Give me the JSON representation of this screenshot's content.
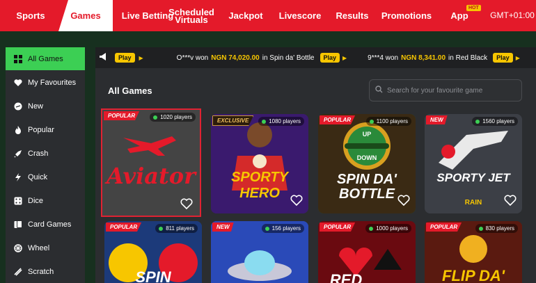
{
  "nav": {
    "items": [
      {
        "label": "Sports"
      },
      {
        "label": "Games"
      },
      {
        "label": "Live Betting"
      },
      {
        "label": "Scheduled"
      },
      {
        "label": "Virtuals"
      },
      {
        "label": "Jackpot"
      },
      {
        "label": "Livescore"
      },
      {
        "label": "Results"
      },
      {
        "label": "Promotions"
      },
      {
        "label": "App"
      },
      {
        "label": "GMT+01:00"
      }
    ],
    "hot_badge": "HOT",
    "active": "Games"
  },
  "sidebar": {
    "items": [
      {
        "label": "All Games",
        "icon": "grid-icon"
      },
      {
        "label": "My Favourites",
        "icon": "heart-icon"
      },
      {
        "label": "New",
        "icon": "new-badge-icon"
      },
      {
        "label": "Popular",
        "icon": "flame-icon"
      },
      {
        "label": "Crash",
        "icon": "rocket-icon"
      },
      {
        "label": "Quick",
        "icon": "lightning-icon"
      },
      {
        "label": "Dice",
        "icon": "dice-icon"
      },
      {
        "label": "Card Games",
        "icon": "cards-icon"
      },
      {
        "label": "Wheel",
        "icon": "wheel-icon"
      },
      {
        "label": "Scratch",
        "icon": "scratch-icon"
      }
    ],
    "active": "All Games"
  },
  "ticker": {
    "play_label": "Play",
    "entries": [
      {
        "user": "O***v won",
        "amount": "NGN 74,020.00",
        "game": "in Spin da' Bottle"
      },
      {
        "user": "9***4 won",
        "amount": "NGN 8,341.00",
        "game": "in Red Black"
      }
    ]
  },
  "main": {
    "title": "All Games",
    "search_placeholder": "Search for your favourite game"
  },
  "games": [
    {
      "name": "Aviator",
      "tag": "POPULAR",
      "players": "1020 players"
    },
    {
      "name": "SPORTY HERO",
      "tag": "EXCLUSIVE",
      "players": "1080 players"
    },
    {
      "name": "SPIN DA' BOTTLE",
      "tag": "POPULAR",
      "players": "1100 players",
      "up": "UP",
      "down": "DOWN"
    },
    {
      "name": "SPORTY JET",
      "tag": "NEW",
      "players": "1560 players",
      "sub": "RAIN"
    },
    {
      "name": "SPIN",
      "tag": "POPULAR",
      "players": "811 players"
    },
    {
      "name": "",
      "tag": "NEW",
      "players": "156 players"
    },
    {
      "name": "RED",
      "tag": "POPULAR",
      "players": "1000 players"
    },
    {
      "name": "FLIP DA'",
      "tag": "POPULAR",
      "players": "830 players"
    }
  ],
  "colors": {
    "brand_red": "#e41a2a",
    "accent_green": "#3ccf54",
    "accent_yellow": "#f7c600",
    "panel": "#2b2d30"
  }
}
